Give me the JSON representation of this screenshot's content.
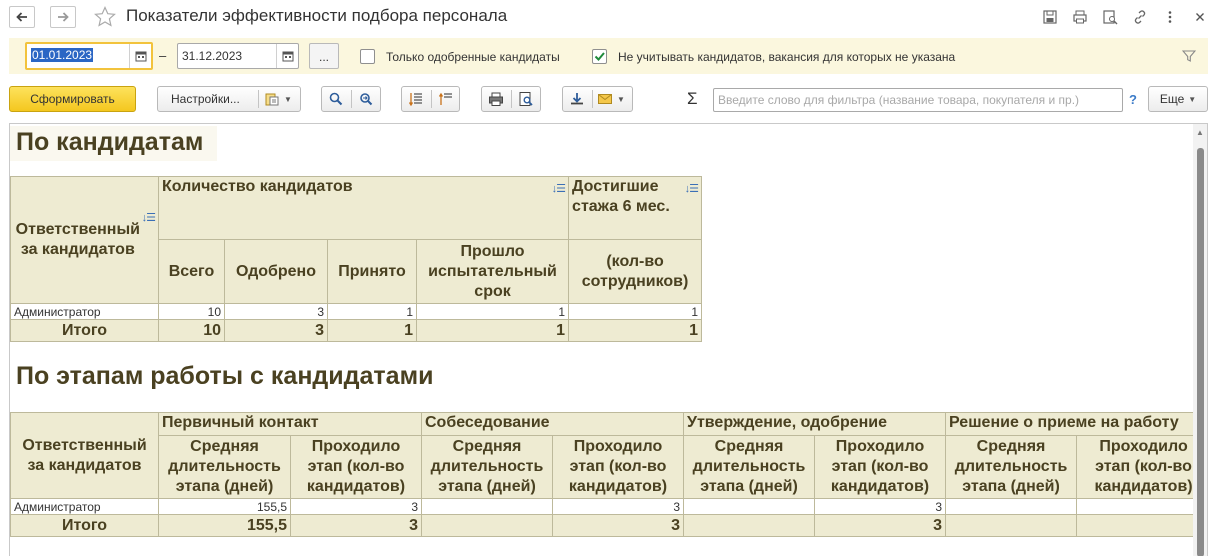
{
  "window": {
    "title": "Показатели эффективности подбора персонала"
  },
  "filters": {
    "date_from": "01.01.2023",
    "date_separator": "–",
    "date_to": "31.12.2023",
    "more_label": "...",
    "only_approved_label": "Только одобренные кандидаты",
    "only_approved_checked": false,
    "ignore_no_vacancy_label": "Не учитывать кандидатов, вакансия для которых не указана",
    "ignore_no_vacancy_checked": true
  },
  "toolbar": {
    "generate_label": "Сформировать",
    "settings_label": "Настройки...",
    "sigma": "Σ",
    "search_placeholder": "Введите слово для фильтра (название товара, покупателя и пр.)",
    "help": "?",
    "more_label": "Еще"
  },
  "section1": {
    "title": "По кандидатам",
    "col_responsible": "Ответственный за кандидатов",
    "group_count": "Количество кандидатов",
    "col_total": "Всего",
    "col_approved": "Одобрено",
    "col_accepted": "Принято",
    "col_probation": "Прошло испытательный срок",
    "col_tenure_top": "Достигшие стажа 6 мес.",
    "col_tenure_bottom": "(кол-во сотрудников)",
    "rows": [
      {
        "name": "Администратор",
        "total": "10",
        "approved": "3",
        "accepted": "1",
        "probation": "1",
        "tenure": "1"
      }
    ],
    "totals": {
      "label": "Итого",
      "total": "10",
      "approved": "3",
      "accepted": "1",
      "probation": "1",
      "tenure": "1"
    }
  },
  "section2": {
    "title": "По этапам работы с кандидатами",
    "col_responsible": "Ответственный за кандидатов",
    "stages": [
      "Первичный контакт",
      "Собеседование",
      "Утверждение, одобрение",
      "Решение о приеме на работу"
    ],
    "sub_duration": "Средняя длительность этапа (дней)",
    "sub_count": "Проходило этап (кол-во кандидатов)",
    "rows": [
      {
        "name": "Администратор",
        "values": [
          "155,5",
          "3",
          "",
          "3",
          "",
          "3",
          "",
          ""
        ]
      }
    ],
    "totals": {
      "label": "Итого",
      "values": [
        "155,5",
        "3",
        "",
        "3",
        "",
        "3",
        "",
        ""
      ]
    }
  }
}
